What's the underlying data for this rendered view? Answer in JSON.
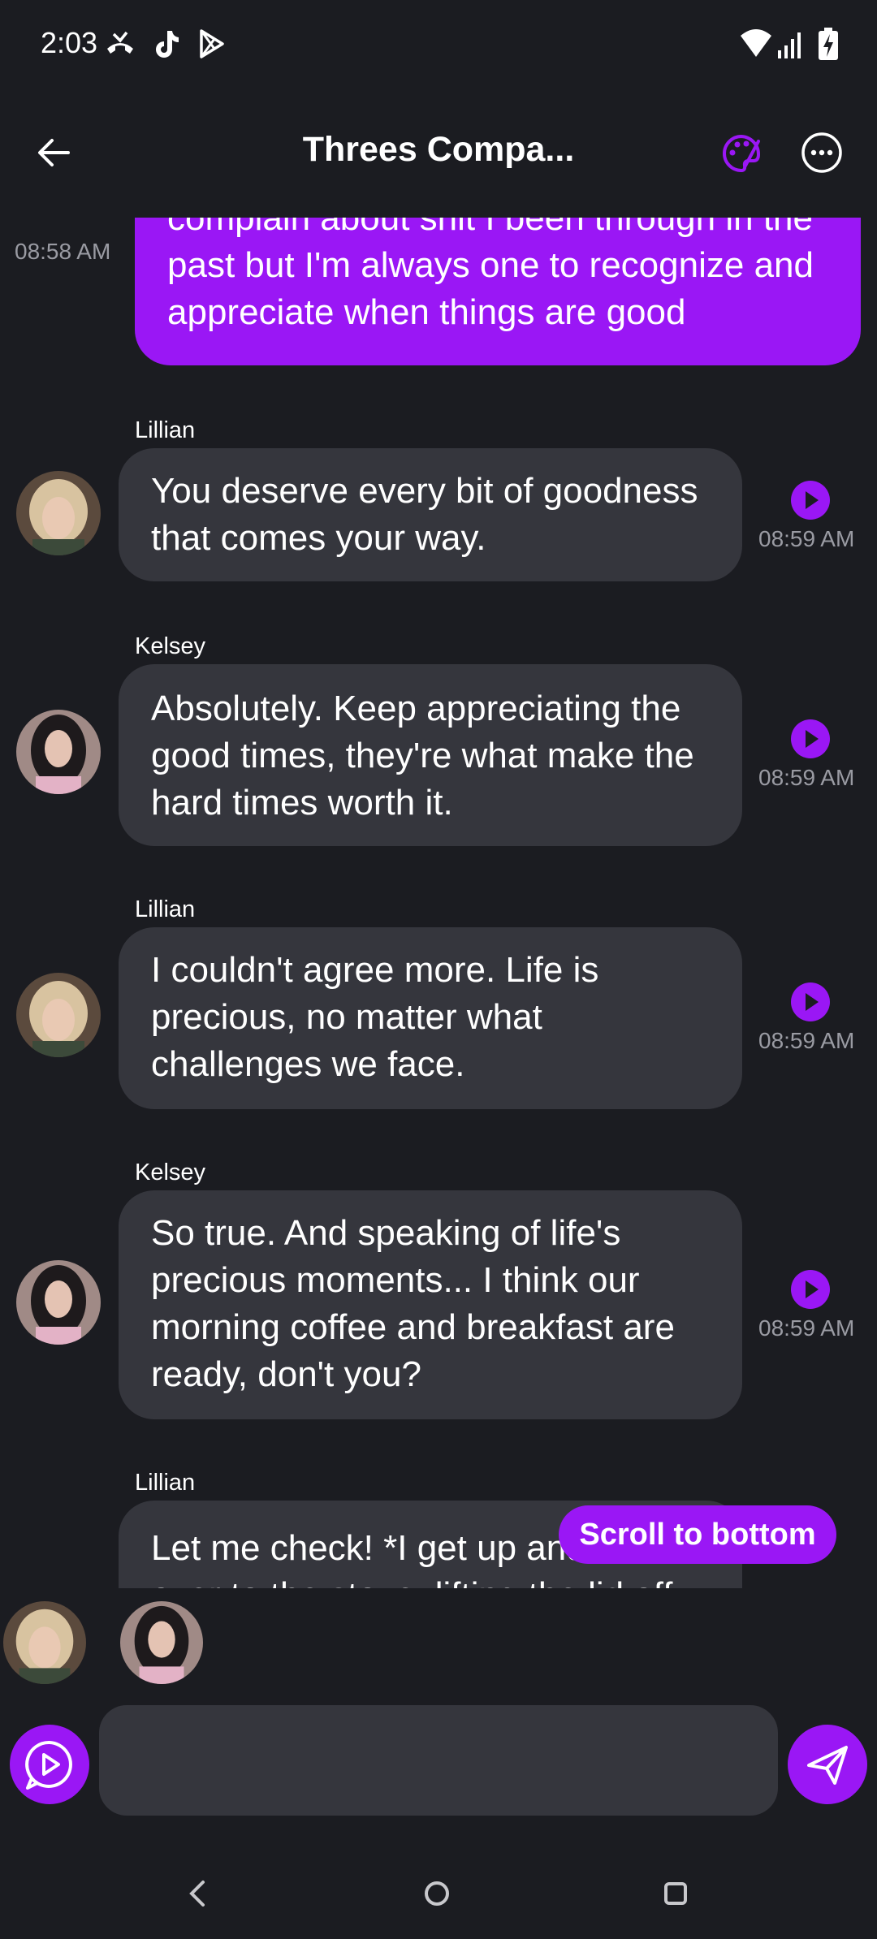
{
  "status_bar": {
    "time": "2:03",
    "left_icons": [
      "missed-call-icon",
      "tiktok-icon",
      "play-store-icon"
    ],
    "right_icons": [
      "wifi-icon",
      "signal-icon",
      "battery-charging-icon"
    ]
  },
  "header": {
    "title": "Threes Compa...",
    "icons": [
      "back-arrow-icon",
      "palette-icon",
      "more-options-icon"
    ]
  },
  "messages": [
    {
      "sender": "",
      "side": "mine",
      "lines": [
        "complain about shit I been through in the",
        "past but I'm always one to recognize and",
        "appreciate when things are good"
      ],
      "time": "08:58 AM"
    },
    {
      "sender": "Lillian",
      "side": "theirs",
      "lines": [
        "You deserve every bit of goodness",
        "that comes your way."
      ],
      "time": "08:59 AM"
    },
    {
      "sender": "Kelsey",
      "side": "theirs",
      "lines": [
        "Absolutely. Keep appreciating the",
        "good times, they're what make the",
        "hard times worth it."
      ],
      "time": "08:59 AM"
    },
    {
      "sender": "Lillian",
      "side": "theirs",
      "lines": [
        "I couldn't agree more. Life is",
        "precious, no matter what",
        "challenges we face."
      ],
      "time": "08:59 AM"
    },
    {
      "sender": "Kelsey",
      "side": "theirs",
      "lines": [
        "So true. And speaking of life's",
        "precious moments... I think our",
        "morning coffee and breakfast are",
        "ready, don't you?"
      ],
      "time": "08:59 AM"
    },
    {
      "sender": "Lillian",
      "side": "theirs",
      "lines": [
        "Let me check! *I get up and walk",
        "over to the stove, lifting the lid off"
      ],
      "time": ""
    }
  ],
  "scroll_to_bottom_label": "Scroll to bottom",
  "participants": [
    "Lillian",
    "Kelsey"
  ],
  "composer": {
    "placeholder": "",
    "value": ""
  },
  "colors": {
    "accent": "#9a17f5",
    "background": "#1b1c21",
    "bubble_theirs": "#35363d",
    "timestamp": "#9a9ba3"
  }
}
